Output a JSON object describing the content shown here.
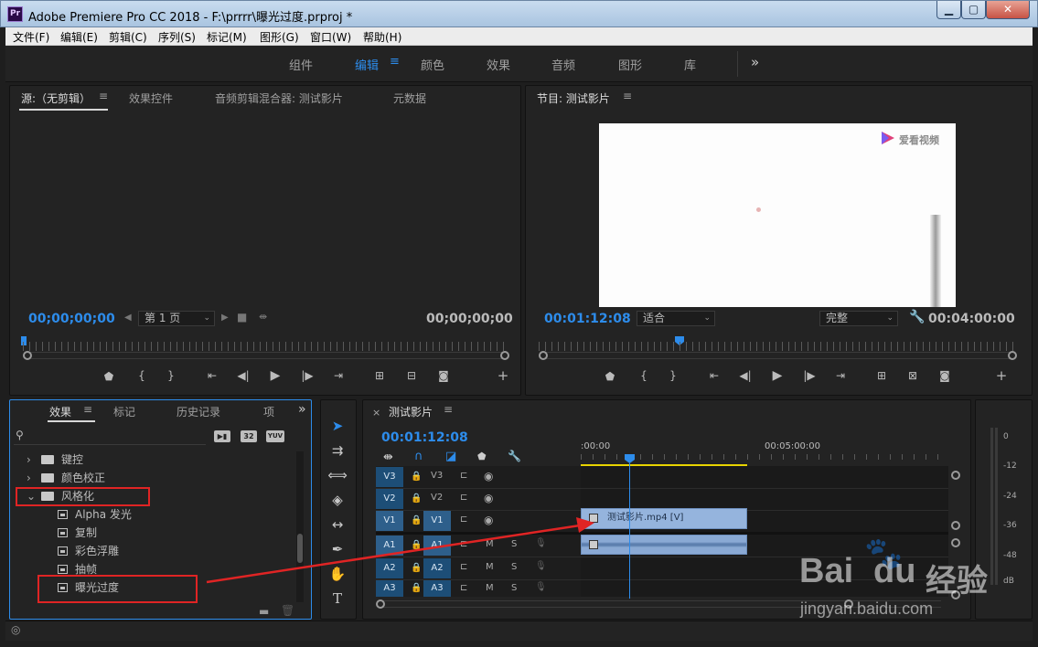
{
  "window": {
    "title": "Adobe Premiere Pro CC 2018 - F:\\prrrr\\曝光过度.prproj *",
    "app_icon": "Pr"
  },
  "menu": [
    "文件(F)",
    "编辑(E)",
    "剪辑(C)",
    "序列(S)",
    "标记(M)",
    "图形(G)",
    "窗口(W)",
    "帮助(H)"
  ],
  "workspaces": [
    "组件",
    "编辑",
    "颜色",
    "效果",
    "音频",
    "图形",
    "库"
  ],
  "workspace_active": "编辑",
  "workspace_more": "»",
  "source_panel": {
    "tabs": [
      "源:（无剪辑）",
      "效果控件",
      "音频剪辑混合器: 测试影片",
      "元数据"
    ],
    "timecode_left": "00;00;00;00",
    "page_label": "第 1 页",
    "timecode_right": "00;00;00;00"
  },
  "program_panel": {
    "title": "节目: 测试影片",
    "timecode_left": "00:01:12:08",
    "fit_label": "适合",
    "quality_label": "完整",
    "timecode_right": "00:04:00:00",
    "watermark": "爱看视频"
  },
  "effects_panel": {
    "tabs": [
      "效果",
      "标记",
      "历史记录",
      "项"
    ],
    "more": "»",
    "badges": [
      "32",
      "YUV"
    ],
    "tree": [
      {
        "label": "键控",
        "type": "folder",
        "expanded": false
      },
      {
        "label": "颜色校正",
        "type": "folder",
        "expanded": false
      },
      {
        "label": "风格化",
        "type": "folder",
        "expanded": true
      },
      {
        "label": "Alpha 发光",
        "type": "effect"
      },
      {
        "label": "复制",
        "type": "effect"
      },
      {
        "label": "彩色浮雕",
        "type": "effect"
      },
      {
        "label": "抽帧",
        "type": "effect"
      },
      {
        "label": "曝光过度",
        "type": "effect"
      }
    ]
  },
  "timeline": {
    "title": "测试影片",
    "timecode": "00:01:12:08",
    "ruler_labels": [
      ":00:00",
      "00:05:00:00"
    ],
    "tracks": [
      {
        "src": "V3",
        "tgt": "V3"
      },
      {
        "src": "V2",
        "tgt": "V2"
      },
      {
        "src": "V1",
        "tgt": "V1"
      },
      {
        "src": "A1",
        "tgt": "A1"
      },
      {
        "src": "A2",
        "tgt": "A2"
      },
      {
        "src": "A3",
        "tgt": "A3"
      }
    ],
    "mute_label": "M",
    "solo_label": "S",
    "clip_label": "测试影片.mp4 [V]"
  },
  "meter": {
    "labels": [
      "0",
      "-12",
      "-24",
      "-36",
      "-48",
      "dB"
    ]
  },
  "baidu_watermark": {
    "logo_text": "Bai",
    "logo_text2": "du",
    "brand": "经验",
    "url": "jingyan.baidu.com"
  },
  "colors": {
    "accent": "#2d8ceb",
    "highlight_box": "#e02424",
    "clip": "#95b4dd"
  }
}
